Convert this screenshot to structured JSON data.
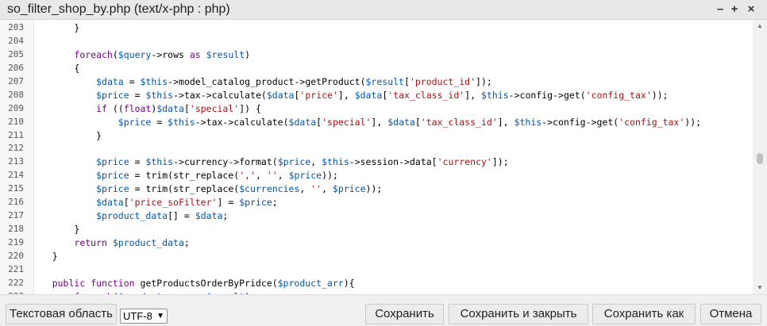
{
  "window": {
    "title": "so_filter_shop_by.php (text/x-php : php)",
    "controls": [
      "–",
      "+",
      "×"
    ]
  },
  "editor": {
    "lines": [
      {
        "n": "203",
        "code": "        }"
      },
      {
        "n": "204",
        "code": ""
      },
      {
        "n": "205",
        "code": "        foreach($query->rows as $result)"
      },
      {
        "n": "206",
        "code": "        {"
      },
      {
        "n": "207",
        "code": "            $data = $this->model_catalog_product->getProduct($result['product_id']);"
      },
      {
        "n": "208",
        "code": "            $price = $this->tax->calculate($data['price'], $data['tax_class_id'], $this->config->get('config_tax'));"
      },
      {
        "n": "209",
        "code": "            if ((float)$data['special']) {"
      },
      {
        "n": "210",
        "code": "                $price = $this->tax->calculate($data['special'], $data['tax_class_id'], $this->config->get('config_tax'));"
      },
      {
        "n": "211",
        "code": "            }"
      },
      {
        "n": "212",
        "code": ""
      },
      {
        "n": "213",
        "code": "            $price = $this->currency->format($price, $this->session->data['currency']);"
      },
      {
        "n": "214",
        "code": "            $price = trim(str_replace(',', '', $price));"
      },
      {
        "n": "215",
        "code": "            $price = trim(str_replace($currencies, '', $price));"
      },
      {
        "n": "216",
        "code": "            $data['price_soFilter'] = $price;"
      },
      {
        "n": "217",
        "code": "            $product_data[] = $data;"
      },
      {
        "n": "218",
        "code": "        }"
      },
      {
        "n": "219",
        "code": "        return $product_data;"
      },
      {
        "n": "220",
        "code": "    }"
      },
      {
        "n": "221",
        "code": ""
      },
      {
        "n": "222",
        "code": "    public function getProductsOrderByPridce($product_arr){"
      },
      {
        "n": "223",
        "code": "        foreach($product_arr as $result)"
      }
    ]
  },
  "footer": {
    "textarea_button": "Текстовая область",
    "encoding": "UTF-8",
    "save": "Сохранить",
    "save_close": "Сохранить и закрыть",
    "save_as": "Сохранить как",
    "cancel": "Отмена"
  },
  "colors": {
    "keyword": "#770088",
    "variable": "#0055aa",
    "string": "#aa1111",
    "default": "#000000"
  }
}
